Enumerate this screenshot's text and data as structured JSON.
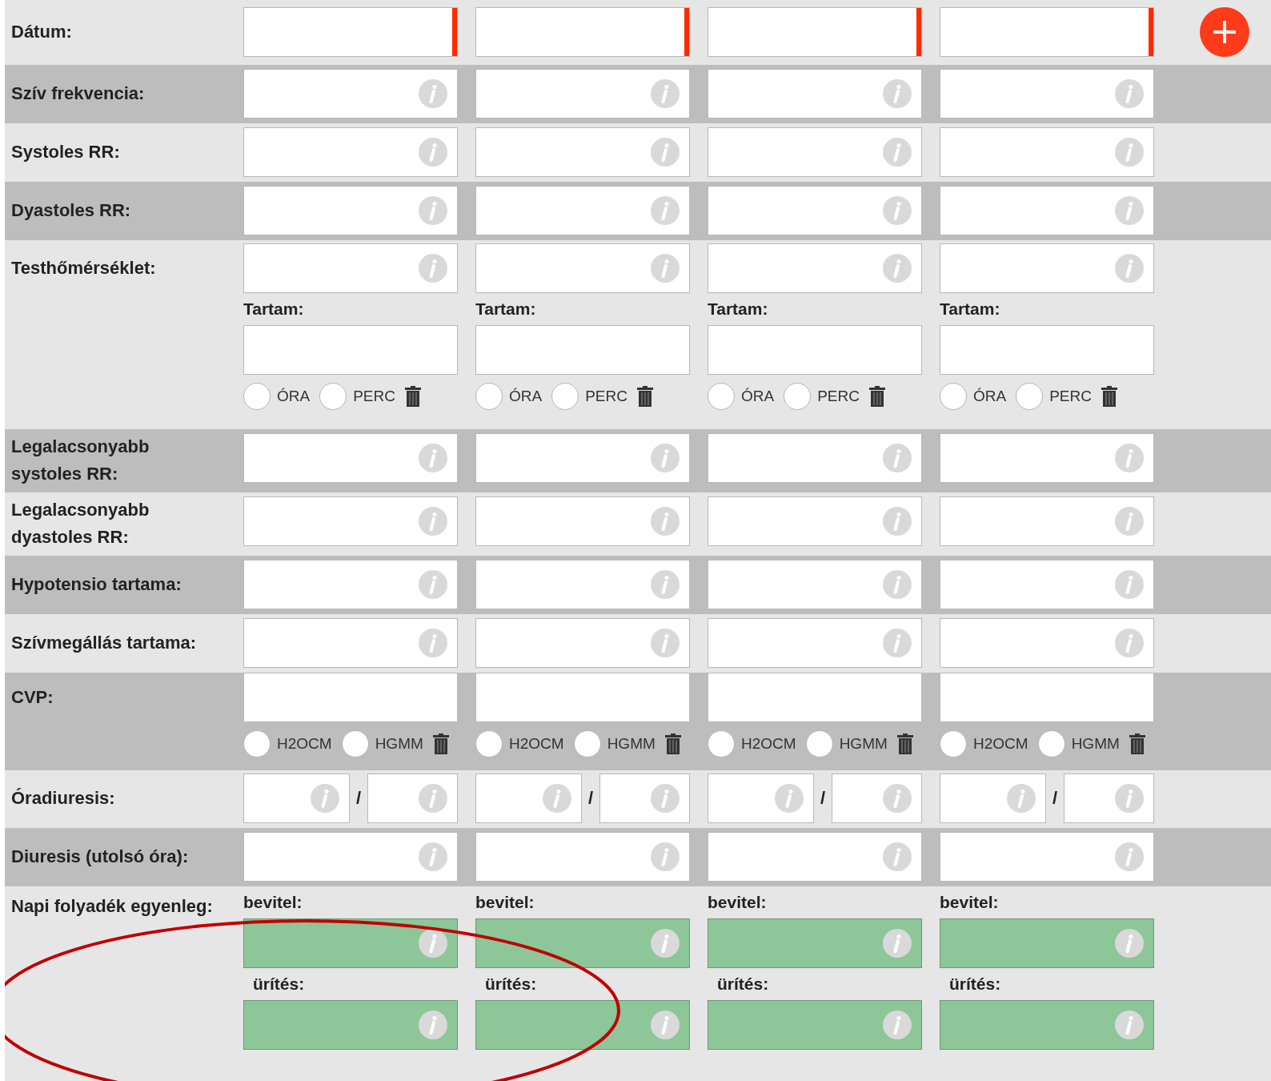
{
  "rows": [
    {
      "kind": "date",
      "label": "Dátum:",
      "shaded": false,
      "cells": [
        {
          "required": true
        },
        {
          "required": true
        },
        {
          "required": true
        },
        {
          "required": true
        }
      ]
    },
    {
      "kind": "info",
      "label": "Szív frekvencia:",
      "shaded": true,
      "cells": [
        {
          "info": true
        },
        {
          "info": true
        },
        {
          "info": true
        },
        {
          "info": true
        }
      ]
    },
    {
      "kind": "info",
      "label": "Systoles RR:",
      "shaded": false,
      "cells": [
        {
          "info": true
        },
        {
          "info": true
        },
        {
          "info": true
        },
        {
          "info": true
        }
      ]
    },
    {
      "kind": "info",
      "label": "Dyastoles RR:",
      "shaded": true,
      "cells": [
        {
          "info": true
        },
        {
          "info": true
        },
        {
          "info": true
        },
        {
          "info": true
        }
      ]
    },
    {
      "kind": "temp",
      "label": "Testhőmérséklet:",
      "shaded": false,
      "cells": [
        {
          "info": true,
          "sub_label": "Tartam:",
          "units": [
            {
              "label": "ÓRA",
              "selected": false
            },
            {
              "label": "PERC",
              "selected": false
            }
          ]
        },
        {
          "info": true,
          "sub_label": "Tartam:",
          "units": [
            {
              "label": "ÓRA",
              "selected": false
            },
            {
              "label": "PERC",
              "selected": false
            }
          ]
        },
        {
          "info": true,
          "sub_label": "Tartam:",
          "units": [
            {
              "label": "ÓRA",
              "selected": false
            },
            {
              "label": "PERC",
              "selected": false
            }
          ]
        },
        {
          "info": true,
          "sub_label": "Tartam:",
          "units": [
            {
              "label": "ÓRA",
              "selected": false
            },
            {
              "label": "PERC",
              "selected": false
            }
          ]
        }
      ]
    },
    {
      "kind": "info",
      "label": "Legalacsonyabb systoles RR:",
      "shaded": true,
      "cells": [
        {
          "info": true
        },
        {
          "info": true
        },
        {
          "info": true
        },
        {
          "info": true
        }
      ]
    },
    {
      "kind": "info",
      "label": "Legalacsonyabb dyastoles RR:",
      "shaded": false,
      "cells": [
        {
          "info": true
        },
        {
          "info": true
        },
        {
          "info": true
        },
        {
          "info": true
        }
      ]
    },
    {
      "kind": "info",
      "label": "Hypotensio tartama:",
      "shaded": true,
      "cells": [
        {
          "info": true
        },
        {
          "info": true
        },
        {
          "info": true
        },
        {
          "info": true
        }
      ]
    },
    {
      "kind": "info",
      "label": "Szívmegállás tartama:",
      "shaded": false,
      "cells": [
        {
          "info": true
        },
        {
          "info": true
        },
        {
          "info": true
        },
        {
          "info": true
        }
      ]
    },
    {
      "kind": "cvp",
      "label": "CVP:",
      "shaded": true,
      "cells": [
        {
          "units": [
            {
              "label": "H2OCM",
              "selected": false
            },
            {
              "label": "HGMM",
              "selected": false
            }
          ]
        },
        {
          "units": [
            {
              "label": "H2OCM",
              "selected": false
            },
            {
              "label": "HGMM",
              "selected": false
            }
          ]
        },
        {
          "units": [
            {
              "label": "H2OCM",
              "selected": false
            },
            {
              "label": "HGMM",
              "selected": false
            }
          ]
        },
        {
          "units": [
            {
              "label": "H2OCM",
              "selected": false
            },
            {
              "label": "HGMM",
              "selected": false
            }
          ]
        }
      ]
    },
    {
      "kind": "split",
      "label": "Óradiuresis:",
      "shaded": false,
      "cells": [
        {
          "separator": "/"
        },
        {
          "separator": "/"
        },
        {
          "separator": "/"
        },
        {
          "separator": "/"
        }
      ]
    },
    {
      "kind": "info",
      "label": "Diuresis (utolsó óra):",
      "shaded": true,
      "cells": [
        {
          "info": true
        },
        {
          "info": true
        },
        {
          "info": true
        },
        {
          "info": true
        }
      ]
    },
    {
      "kind": "fluid",
      "label": "Napi folyadék egyenleg:",
      "shaded": false,
      "cells": [
        {
          "in_label": "bevitel:",
          "out_label": "ürítés:"
        },
        {
          "in_label": "bevitel:",
          "out_label": "ürítés:"
        },
        {
          "in_label": "bevitel:",
          "out_label": "ürítés:"
        },
        {
          "in_label": "bevitel:",
          "out_label": "ürítés:"
        }
      ]
    }
  ]
}
